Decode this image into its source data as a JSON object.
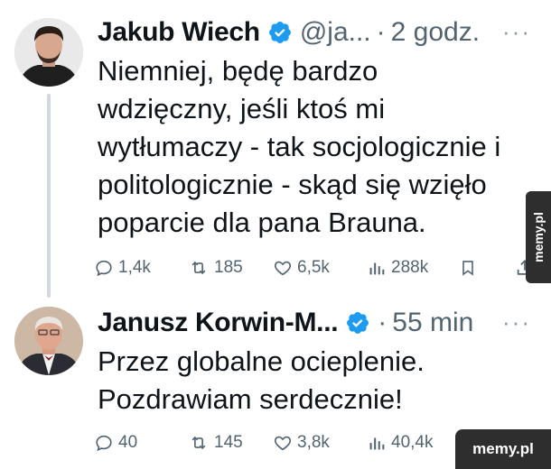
{
  "tweets": [
    {
      "name": "Jakub Wiech",
      "handle": "@ja...",
      "time": "2 godz.",
      "more": "···",
      "text_lines": [
        "Niemniej, będę bardzo",
        "wdzięczny, jeśli ktoś mi",
        "wytłumaczy - tak socjologicznie i",
        "politologicznie - skąd się wzięło",
        "poparcie dla pana Brauna."
      ],
      "replies": "1,4k",
      "retweets": "185",
      "likes": "6,5k",
      "views": "288k"
    },
    {
      "name": "Janusz Korwin-M...",
      "time": "55 min",
      "more": "···",
      "text_lines": [
        "Przez globalne ocieplenie.",
        "Pozdrawiam serdecznie!"
      ],
      "replies": "40",
      "retweets": "145",
      "likes": "3,8k",
      "views": "40,4k"
    }
  ],
  "watermark": {
    "side": "memy.pl",
    "corner": "memy.pl"
  },
  "colors": {
    "verified": "#1d9bf0",
    "muted": "#536471",
    "thread_line": "#cfd9de"
  }
}
